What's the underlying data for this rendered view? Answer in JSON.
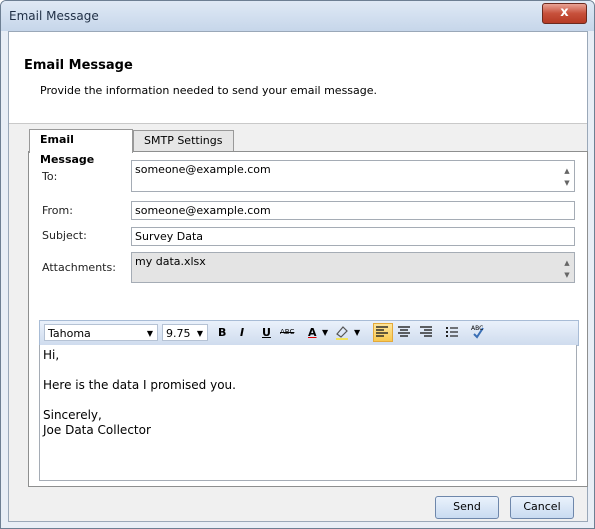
{
  "window": {
    "title": "Email Message",
    "close_label": "x"
  },
  "header": {
    "title": "Email Message",
    "subtitle": "Provide the information needed to send your email message."
  },
  "tabs": [
    {
      "label": "Email Message"
    },
    {
      "label": "SMTP Settings"
    }
  ],
  "form": {
    "to_label": "To:",
    "to_value": "someone@example.com",
    "from_label": "From:",
    "from_value": "someone@example.com",
    "subject_label": "Subject:",
    "subject_value": "Survey Data",
    "attachments_label": "Attachments:",
    "attachments_value": "my data.xlsx"
  },
  "toolbar": {
    "font": "Tahoma",
    "size": "9.75",
    "bold": "B",
    "italic": "I",
    "underline": "U",
    "strike": "ABC",
    "font_color": "A",
    "spell": "ABC",
    "icons": [
      "chevron-down-icon",
      "bold-icon",
      "italic-icon",
      "underline-icon",
      "strikethrough-icon",
      "font-color-icon",
      "highlight-icon",
      "align-left-icon",
      "align-center-icon",
      "align-right-icon",
      "bullet-list-icon",
      "spellcheck-icon"
    ]
  },
  "body_lines": [
    "Hi,",
    "",
    "Here is the data I promised you.",
    "",
    "Sincerely,",
    "Joe Data Collector"
  ],
  "buttons": {
    "send": "Send",
    "cancel": "Cancel"
  },
  "colors": {
    "accent": "#c7503b",
    "toolbar_bg": "#cfdcee"
  }
}
